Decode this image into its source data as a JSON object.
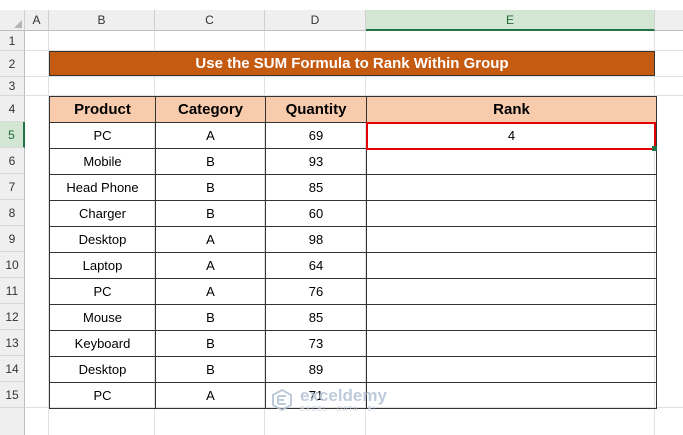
{
  "columns": [
    "A",
    "B",
    "C",
    "D",
    "E"
  ],
  "rows": [
    "1",
    "2",
    "3",
    "4",
    "5",
    "6",
    "7",
    "8",
    "9",
    "10",
    "11",
    "12",
    "13",
    "14",
    "15"
  ],
  "title": "Use the SUM Formula to Rank Within Group",
  "table": {
    "headers": [
      "Product",
      "Category",
      "Quantity",
      "Rank"
    ],
    "rows": [
      {
        "product": "PC",
        "category": "A",
        "quantity": "69",
        "rank": "4"
      },
      {
        "product": "Mobile",
        "category": "B",
        "quantity": "93",
        "rank": ""
      },
      {
        "product": "Head Phone",
        "category": "B",
        "quantity": "85",
        "rank": ""
      },
      {
        "product": "Charger",
        "category": "B",
        "quantity": "60",
        "rank": ""
      },
      {
        "product": "Desktop",
        "category": "A",
        "quantity": "98",
        "rank": ""
      },
      {
        "product": "Laptop",
        "category": "A",
        "quantity": "64",
        "rank": ""
      },
      {
        "product": "PC",
        "category": "A",
        "quantity": "76",
        "rank": ""
      },
      {
        "product": "Mouse",
        "category": "B",
        "quantity": "85",
        "rank": ""
      },
      {
        "product": "Keyboard",
        "category": "B",
        "quantity": "73",
        "rank": ""
      },
      {
        "product": "Desktop",
        "category": "B",
        "quantity": "89",
        "rank": ""
      },
      {
        "product": "PC",
        "category": "A",
        "quantity": "71",
        "rank": ""
      }
    ]
  },
  "selection": {
    "column": "E",
    "row": "5"
  },
  "watermark": {
    "name": "exceldemy",
    "tagline": "EXCEL · DATA · BI"
  },
  "colors": {
    "title_bg": "#c55a11",
    "header_bg": "#f8cbad",
    "selection_border": "#e30000",
    "excel_green": "#217346"
  }
}
